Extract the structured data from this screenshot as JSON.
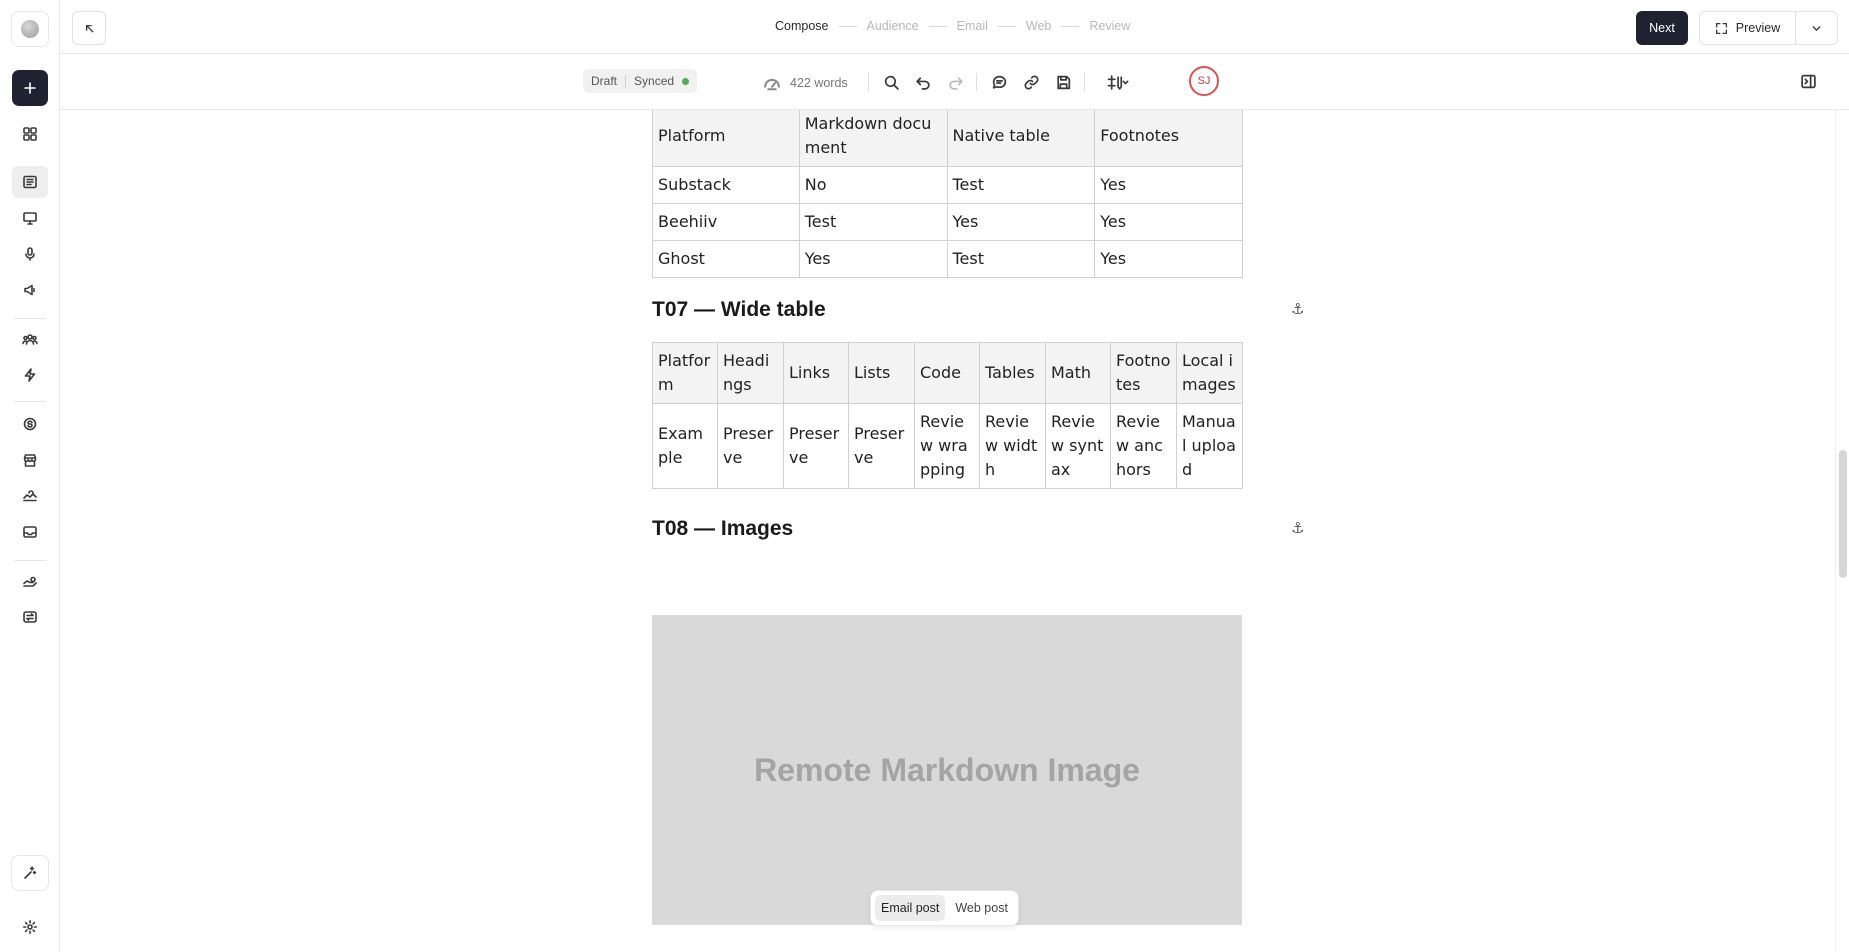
{
  "steps": {
    "compose": "Compose",
    "audience": "Audience",
    "email": "Email",
    "web": "Web",
    "review": "Review"
  },
  "header": {
    "next_label": "Next",
    "preview_label": "Preview"
  },
  "toolbar": {
    "draft_label": "Draft",
    "synced_label": "Synced",
    "word_count": "422 words",
    "avatar_initials": "SJ"
  },
  "table1": {
    "headers": [
      "Platform",
      "Markdown document",
      "Native table",
      "Footnotes"
    ],
    "rows": [
      [
        "Substack",
        "No",
        "Test",
        "Yes"
      ],
      [
        "Beehiiv",
        "Test",
        "Yes",
        "Yes"
      ],
      [
        "Ghost",
        "Yes",
        "Test",
        "Yes"
      ]
    ]
  },
  "section_t07": {
    "heading": "T07 — Wide table"
  },
  "table2": {
    "headers": [
      "Platform",
      "Headings",
      "Links",
      "Lists",
      "Code",
      "Tables",
      "Math",
      "Footnotes",
      "Local images"
    ],
    "rows": [
      [
        "Example",
        "Preserve",
        "Preserve",
        "Preserve",
        "Review wrapping",
        "Review width",
        "Review syntax",
        "Review anchors",
        "Manual upload"
      ]
    ]
  },
  "section_t08": {
    "heading": "T08 — Images"
  },
  "image_placeholder": "Remote Markdown Image",
  "post_toggle": {
    "email": "Email post",
    "web": "Web post"
  },
  "colors": {
    "primary_button": "#1f2230",
    "synced_dot": "#4caf50",
    "avatar_ring": "#e05050"
  }
}
